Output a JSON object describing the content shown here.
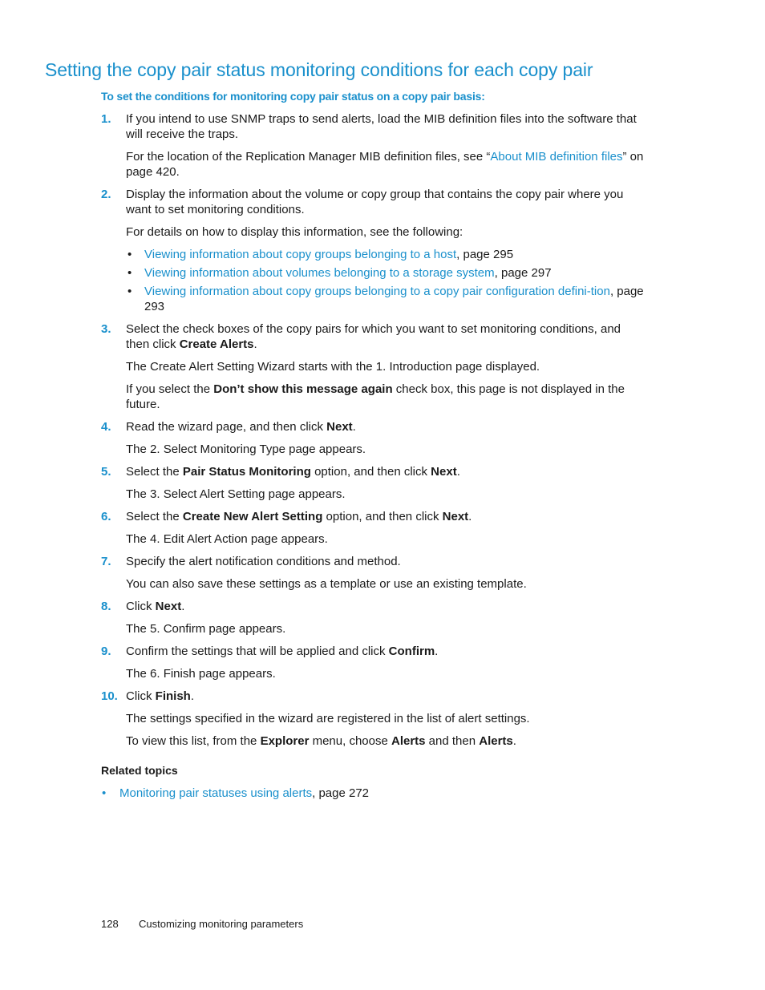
{
  "title": "Setting the copy pair status monitoring conditions for each copy pair",
  "procedure_heading": "To set the conditions for monitoring copy pair status on a copy pair basis:",
  "steps": [
    {
      "num": "1.",
      "text": "If you intend to use SNMP traps to send alerts, load the MIB definition files into the software that will receive the traps."
    },
    {
      "num": "2.",
      "text": "Display the information about the volume or copy group that contains the copy pair where you want to set monitoring conditions."
    },
    {
      "num": "3.",
      "text_a": "Select the check boxes of the copy pairs for which you want to set monitoring conditions, and then click ",
      "bold": "Create Alerts",
      "text_b": "."
    },
    {
      "num": "4.",
      "text_a": "Read the wizard page, and then click ",
      "bold": "Next",
      "text_b": "."
    },
    {
      "num": "5.",
      "text_a": "Select the ",
      "bold": "Pair Status Monitoring",
      "text_b": " option, and then click ",
      "bold2": "Next",
      "text_c": "."
    },
    {
      "num": "6.",
      "text_a": "Select the ",
      "bold": "Create New Alert Setting",
      "text_b": " option, and then click ",
      "bold2": "Next",
      "text_c": "."
    },
    {
      "num": "7.",
      "text": "Specify the alert notification conditions and method."
    },
    {
      "num": "8.",
      "text_a": "Click ",
      "bold": "Next",
      "text_b": "."
    },
    {
      "num": "9.",
      "text_a": "Confirm the settings that will be applied and click ",
      "bold": "Confirm",
      "text_b": "."
    },
    {
      "num": "10.",
      "text_a": "Click ",
      "bold": "Finish",
      "text_b": "."
    }
  ],
  "step1_note": {
    "text_a": "For the location of the Replication Manager MIB definition files, see “",
    "link": "About MIB definition files",
    "text_b": "” on page 420."
  },
  "step2_note": "For details on how to display this information, see the following:",
  "step2_links": [
    {
      "link": "Viewing information about copy groups belonging to a host",
      "suffix": ", page 295"
    },
    {
      "link": "Viewing information about volumes belonging to a storage system",
      "suffix": ", page 297"
    },
    {
      "link": "Viewing information about copy groups belonging to a copy pair configuration defini-tion",
      "suffix": ", page 293"
    }
  ],
  "step3_notes": {
    "note1": "The Create Alert Setting Wizard starts with the 1. Introduction page displayed.",
    "note2_a": "If you select the ",
    "note2_bold": "Don’t show this message again",
    "note2_b": " check box, this page is not displayed in the future."
  },
  "step4_note": "The 2. Select Monitoring Type page appears.",
  "step5_note": "The 3. Select Alert Setting page appears.",
  "step6_note": "The 4. Edit Alert Action page appears.",
  "step7_note": "You can also save these settings as a template or use an existing template.",
  "step8_note": "The 5. Confirm page appears.",
  "step9_note": "The 6. Finish page appears.",
  "step10_notes": {
    "note1": "The settings specified in the wizard are registered in the list of alert settings.",
    "note2_a": "To view this list, from the ",
    "note2_bold1": "Explorer",
    "note2_b": " menu, choose ",
    "note2_bold2": "Alerts",
    "note2_c": " and then ",
    "note2_bold3": "Alerts",
    "note2_d": "."
  },
  "bullet_glyph": "•",
  "related": {
    "heading": "Related topics",
    "items": [
      {
        "link": "Monitoring pair statuses using alerts",
        "suffix": ", page 272"
      }
    ]
  },
  "footer": {
    "page_number": "128",
    "section": "Customizing monitoring parameters"
  },
  "colors": {
    "accent_blue": "#1a90cc",
    "text": "#1a1a1a"
  }
}
